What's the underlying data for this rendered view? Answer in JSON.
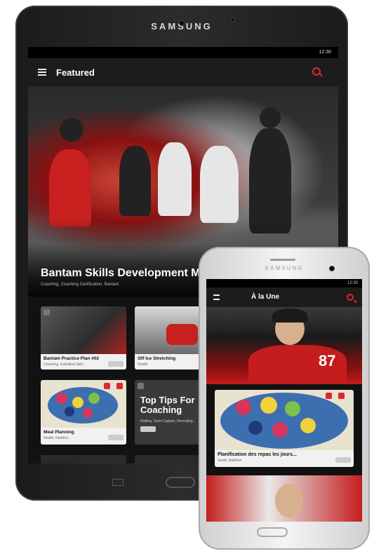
{
  "tablet": {
    "brand": "SAMSUNG",
    "status_time": "12:30",
    "app_title": "Featured",
    "hero": {
      "title": "Bantam Skills Development Manua",
      "subtitle": "Coaching, Coaching Certification, Bantam"
    },
    "cards": [
      {
        "title": "Bantam Practice Plan #02",
        "subtitle": "Coaching, Individual Skill..."
      },
      {
        "title": "Off Ice Stretching",
        "subtitle": "Health"
      },
      {
        "title": "Meal Planning",
        "subtitle": "Health, Nutrition"
      },
      {
        "title": "Top Tips For Coaching",
        "subtitle": "Mailing, Team Captain, Recruiting..."
      }
    ]
  },
  "phone": {
    "brand": "SAMSUNG",
    "status_time": "12:30",
    "app_title": "À la Une",
    "jersey_number": "87",
    "cards": [
      {
        "title": "Planification des repas les jours...",
        "subtitle": "Santé, Nutrition"
      }
    ]
  },
  "colors": {
    "accent": "#e0262b",
    "screen_bg": "#121212",
    "card_foot": "#f1f1f1"
  }
}
